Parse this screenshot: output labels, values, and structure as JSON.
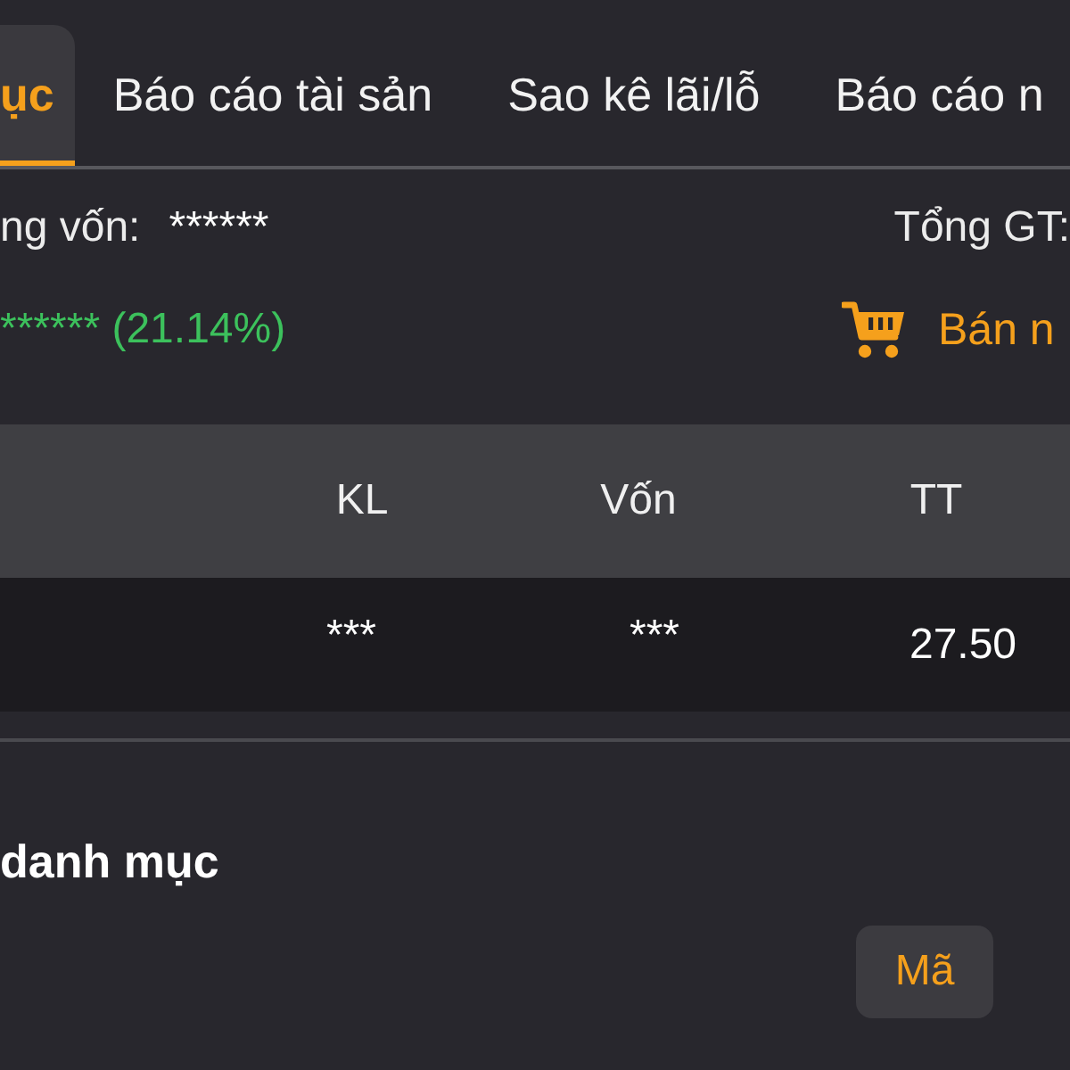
{
  "tabs": [
    {
      "label": "ục",
      "selected": true
    },
    {
      "label": "Báo cáo tài sản",
      "selected": false
    },
    {
      "label": "Sao kê lãi/lỗ",
      "selected": false
    },
    {
      "label": "Báo cáo n",
      "selected": false
    }
  ],
  "summary": {
    "capital_label": "ng vốn:",
    "capital_value": "******",
    "total_label": "Tổng GT:",
    "profit": "****** (21.14%)",
    "profit_positive": true,
    "sell_button": "Bán n"
  },
  "table": {
    "columns": [
      "KL",
      "Vốn",
      "TT"
    ],
    "rows": [
      [
        "***",
        "***",
        "27.50"
      ]
    ]
  },
  "section": {
    "title": "danh mục",
    "sort_options": [
      {
        "label": "Mã",
        "selected": true
      }
    ]
  }
}
